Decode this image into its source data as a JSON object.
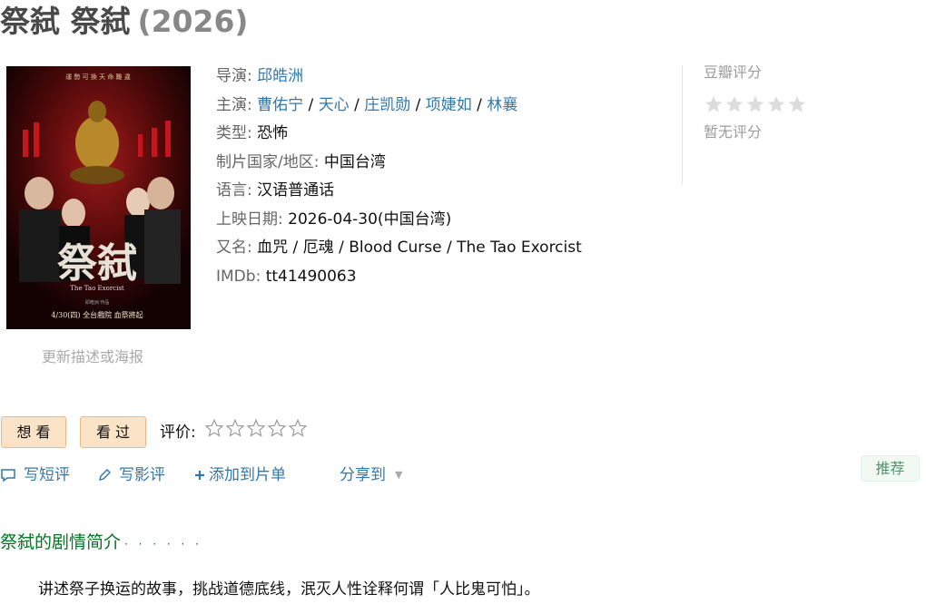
{
  "title": {
    "name": "祭弑 祭弑",
    "year": "(2026)"
  },
  "poster": {
    "top_tagline": "運 勢 可 換 天 命 難 違",
    "calligraphy": "祭弑",
    "english": "The Tao Exorcist",
    "credits": "邱皓洲 作品",
    "release_line": "4/30(四) 全台戲院 血祭將起"
  },
  "update_link": "更新描述或海报",
  "info": {
    "director_label": "导演:",
    "director": "邱皓洲",
    "cast_label": "主演:",
    "cast": [
      "曹佑宁",
      "天心",
      "庄凯勋",
      "项婕如",
      "林襄"
    ],
    "sep": " / ",
    "genre_label": "类型:",
    "genre": "恐怖",
    "country_label": "制片国家/地区:",
    "country": "中国台湾",
    "language_label": "语言:",
    "language": "汉语普通话",
    "release_label": "上映日期:",
    "release": "2026-04-30(中国台湾)",
    "aka_label": "又名:",
    "aka": "血咒 / 厄魂 / Blood Curse / The Tao Exorcist",
    "imdb_label": "IMDb:",
    "imdb": "tt41490063"
  },
  "rating": {
    "label": "豆瓣评分",
    "none": "暂无评分",
    "stars_filled": 0,
    "stars_total": 5,
    "star_color": "#dcdcdc"
  },
  "buttons": {
    "want": "想 看",
    "seen": "看 过"
  },
  "evaluate": {
    "label": "评价:",
    "stars_total": 5
  },
  "actions": {
    "short_review": "写短评",
    "review": "写影评",
    "add_list": "添加到片单",
    "share": "分享到",
    "caret": "▼"
  },
  "recommend": "推荐",
  "synopsis": {
    "title": "祭弑的剧情简介",
    "dots": "· · · · · ·",
    "text": "讲述祭子换运的故事，挑战道德底线，泯灭人性诠释何谓「人比鬼可怕」。"
  },
  "colors": {
    "link": "#37a",
    "green": "#072",
    "button_bg": "#fbe3c8"
  }
}
